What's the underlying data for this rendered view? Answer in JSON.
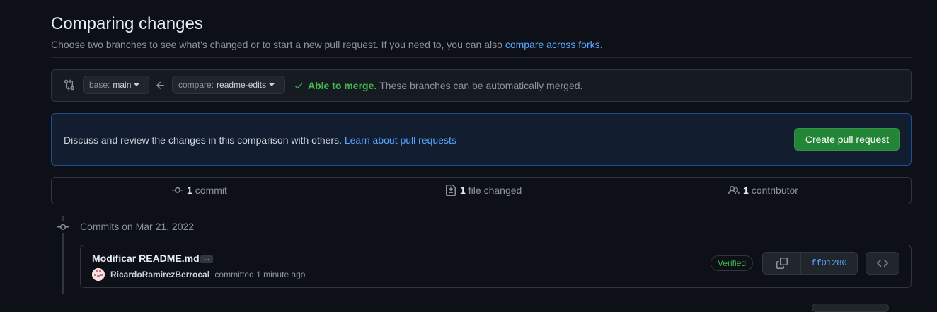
{
  "header": {
    "title": "Comparing changes",
    "subtitle": "Choose two branches to see what’s changed or to start a new pull request. If you need to, you can also",
    "subtitle_link": "compare across forks",
    "subtitle_end": "."
  },
  "range": {
    "base_prefix": "base:",
    "base_branch": "main",
    "compare_prefix": "compare:",
    "compare_branch": "readme-edits",
    "merge_status": "Able to merge.",
    "merge_desc": "These branches can be automatically merged."
  },
  "pr_banner": {
    "text": "Discuss and review the changes in this comparison with others.",
    "link": "Learn about pull requests",
    "button": "Create pull request"
  },
  "stats": {
    "commits_count": "1",
    "commits_label": "commit",
    "files_count": "1",
    "files_label": "file changed",
    "contributors_count": "1",
    "contributors_label": "contributor"
  },
  "commits": {
    "date_header": "Commits on Mar 21, 2022",
    "items": [
      {
        "title": "Modificar README.md",
        "ellipsis": "…",
        "author": "RicardoRamirezBerrocal",
        "action": "committed 1 minute ago",
        "badge": "Verified",
        "sha": "ff01280"
      }
    ]
  },
  "colors": {
    "background": "#0d1117",
    "accent_link": "#58a6ff",
    "success": "#3fb950",
    "primary_button": "#238636"
  },
  "icons": [
    "compare-icon",
    "arrow-left-icon",
    "check-icon",
    "commit-icon",
    "file-diff-icon",
    "people-icon",
    "copy-icon",
    "code-icon",
    "caret-down-icon"
  ]
}
